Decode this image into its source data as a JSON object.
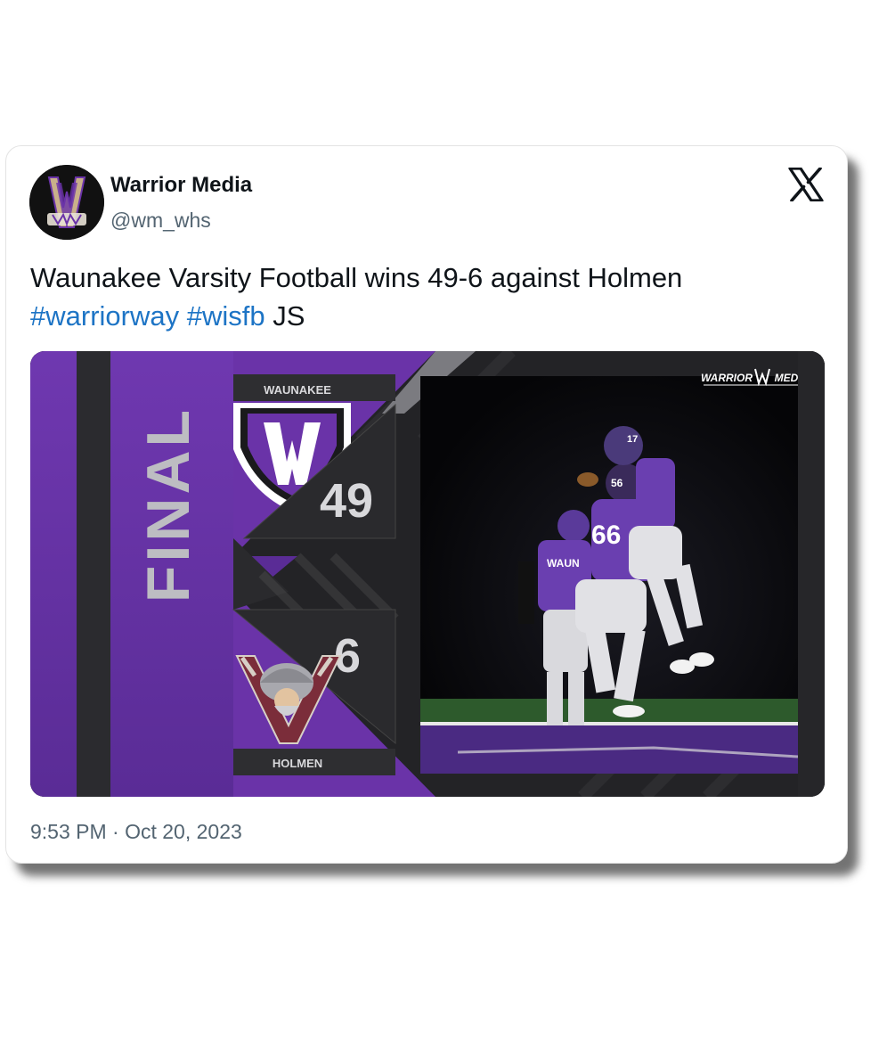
{
  "tweet": {
    "author_name": "Warrior Media",
    "handle": "@wm_whs",
    "text_main": "Waunakee Varsity Football wins 49-6 against Holmen",
    "hashtag1": "#warriorway",
    "hashtag2": "#wisfb",
    "text_suffix": "JS",
    "timestamp": "9:53 PM · Oct 20, 2023",
    "platform_icon": "x-logo-icon",
    "accent_color": "#1d74c5"
  },
  "graphic": {
    "status": "FINAL",
    "home_team": "WAUNAKEE",
    "home_score": "49",
    "away_team": "HOLMEN",
    "away_score": "6",
    "watermark_left": "WARRIOR",
    "watermark_right": "MEDIA",
    "primary_color": "#6a33a8",
    "jersey_number_1": "56",
    "jersey_number_2": "17",
    "jersey_number_3": "66",
    "jersey_text": "WAUN"
  }
}
